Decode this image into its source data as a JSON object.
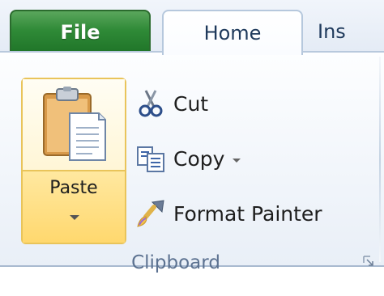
{
  "tabs": {
    "file": "File",
    "home": "Home",
    "insert": "Ins"
  },
  "clipboard": {
    "paste_label": "Paste",
    "cut_label": "Cut",
    "copy_label": "Copy",
    "format_painter_label": "Format Painter",
    "group_label": "Clipboard"
  },
  "icons": {
    "paste": "clipboard-icon",
    "cut": "scissors-icon",
    "copy": "copy-icon",
    "format_painter": "paintbrush-icon",
    "launcher": "dialog-launcher-icon"
  },
  "colors": {
    "file_tab": "#2f8a37",
    "paste_highlight": "#ffd86e",
    "text": "#1e395b"
  }
}
